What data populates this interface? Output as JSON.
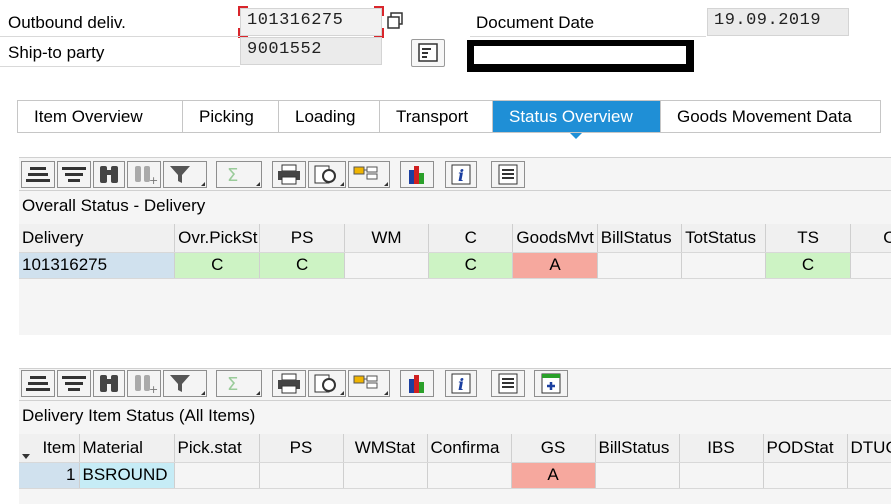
{
  "header": {
    "outbound_label": "Outbound deliv.",
    "outbound_value": "101316275",
    "shipto_label": "Ship-to party",
    "shipto_value": "9001552",
    "docdate_label": "Document Date",
    "docdate_value": "19.09.2019",
    "redacted_name": ""
  },
  "tabs": [
    {
      "label": "Item Overview",
      "active": false
    },
    {
      "label": "Picking",
      "active": false
    },
    {
      "label": "Loading",
      "active": false
    },
    {
      "label": "Transport",
      "active": false
    },
    {
      "label": "Status Overview",
      "active": true
    },
    {
      "label": "Goods Movement Data",
      "active": false
    }
  ],
  "toolbar_icons": [
    "details-icon",
    "filter-icon",
    "find-icon",
    "find-next-icon",
    "set-filter-icon",
    "sum-icon",
    "subtotal-icon",
    "print-icon",
    "export-icon",
    "layout-icon",
    "graphic-icon",
    "info-icon",
    "report-icon",
    "create-icon"
  ],
  "grid1": {
    "title": "Overall Status - Delivery",
    "headers": [
      "Delivery",
      "Ovr.PickSt",
      "PS",
      "WM",
      "C",
      "GoodsMvt",
      "BillStatus",
      "TotStatus",
      "TS",
      "Ov"
    ],
    "row": [
      "101316275",
      "C",
      "C",
      "",
      "C",
      "A",
      "",
      "",
      "C",
      ""
    ]
  },
  "grid2": {
    "title": "Delivery Item Status (All Items)",
    "headers": [
      "Item",
      "Material",
      "Pick.stat",
      "PS",
      "WMStat",
      "Confirma",
      "GS",
      "BillStatus",
      "IBS",
      "PODStat",
      "DTUC"
    ],
    "row": [
      "1",
      "BSROUND",
      "",
      "",
      "",
      "",
      "A",
      "",
      "",
      "",
      ""
    ]
  },
  "colors": {
    "active_tab": "#1f8fd6",
    "status_green": "#cdf3c4",
    "status_red": "#f6a89e",
    "key_cell": "#d0e1ee",
    "focus_frame": "#d9262c"
  }
}
